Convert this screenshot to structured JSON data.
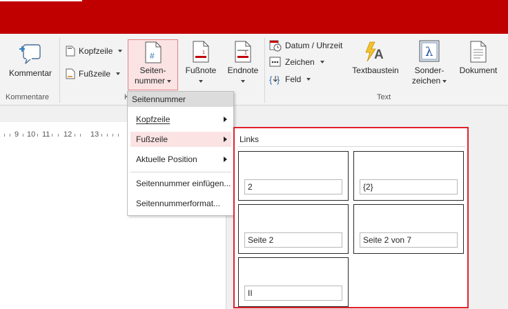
{
  "ribbon": {
    "kommentar_label": "Kommentar",
    "kopfzeile_label": "Kopfzeile",
    "fusszeile_label": "Fußzeile",
    "seitennummer_label_1": "Seiten-",
    "seitennummer_label_2": "nummer",
    "fussnote_label": "Fußnote",
    "endnote_label": "Endnote",
    "datum_label": "Datum / Uhrzeit",
    "zeichen_label": "Zeichen",
    "feld_label": "Feld",
    "textbaustein_label": "Textbaustein",
    "sonderzeichen_label_1": "Sonder-",
    "sonderzeichen_label_2": "zeichen",
    "dokument_label": "Dokument",
    "group_kommentare": "Kommentare",
    "group_k": "K",
    "group_text": "Text",
    "accent_color": "#c00000"
  },
  "ruler": {
    "numbers": [
      "9",
      "10",
      "11",
      "12",
      "13"
    ]
  },
  "menu": {
    "header": "Seitennummer",
    "items": [
      {
        "label": "Kopfzeile",
        "submenu": true
      },
      {
        "label": "Fußzeile",
        "submenu": true,
        "highlighted": true
      },
      {
        "label": "Aktuelle Position",
        "submenu": true
      },
      {
        "label": "Seitennummer einfügen...",
        "submenu": false
      },
      {
        "label": "Seitennummerformat...",
        "submenu": false
      }
    ]
  },
  "gallery": {
    "title": "Links",
    "tiles": [
      "2",
      "{2}",
      "Seite 2",
      "Seite 2 von 7",
      "II"
    ],
    "highlight_color": "#e0202a"
  }
}
